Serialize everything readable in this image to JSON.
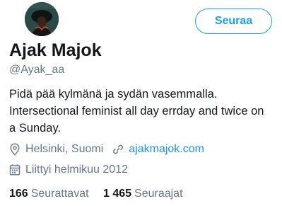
{
  "profile": {
    "avatar_icon": "profile-photo",
    "follow_label": "Seuraa",
    "display_name": "Ajak Majok",
    "handle": "@Ayak_aa",
    "bio_lines": [
      "Pidä pää kylmänä ja sydän vasemmalla.",
      "Intersectional feminist all day errday and twice on",
      "a Sunday."
    ],
    "location": "Helsinki, Suomi",
    "location_icon": "location-pin-icon",
    "website": "ajakmajok.com",
    "link_icon": "link-icon",
    "joined": "Liittyi helmikuu 2012",
    "calendar_icon": "calendar-icon",
    "stats": {
      "following_count": "166",
      "following_label": "Seurattavat",
      "followers_count": "1 465",
      "followers_label": "Seuraajat"
    }
  },
  "colors": {
    "accent": "#1da1f2",
    "link": "#1b95e0",
    "secondary_text": "#657786",
    "primary_text": "#14171a"
  }
}
